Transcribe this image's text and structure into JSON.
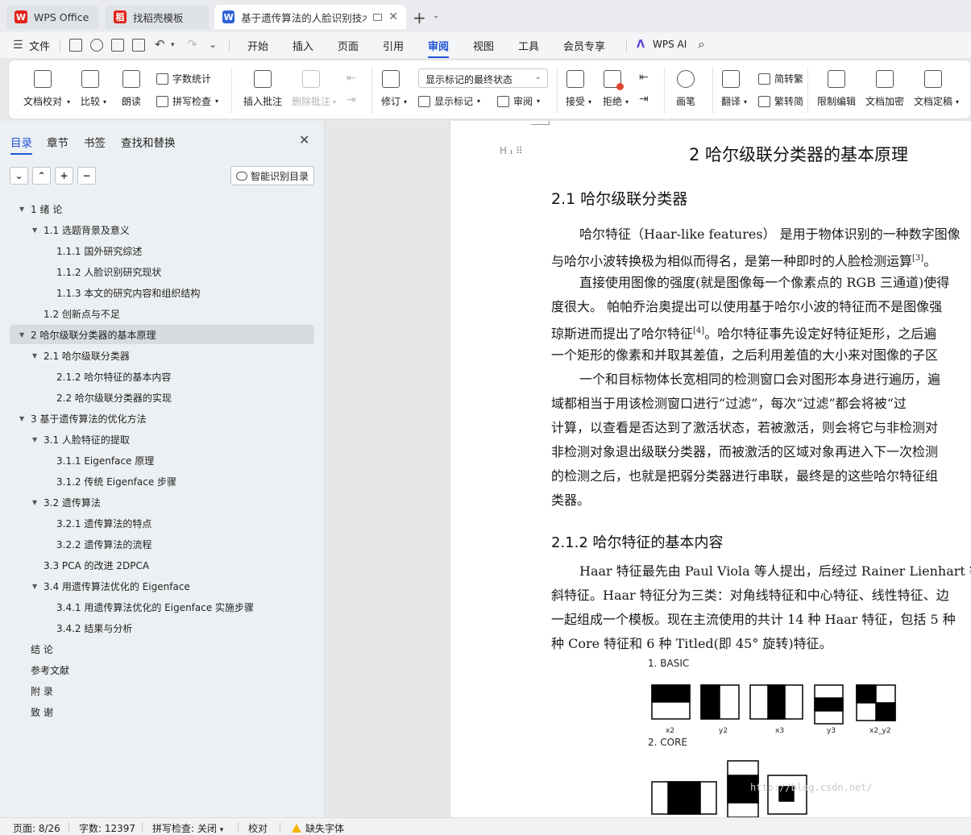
{
  "tabs": [
    {
      "label": "WPS Office",
      "logo": "W",
      "logo_color": "#e2231a"
    },
    {
      "label": "找稻壳模板",
      "logo": "稻",
      "logo_color": "#e2231a"
    },
    {
      "label": "基于遗传算法的人脸识别技术",
      "logo": "W",
      "logo_color": "#2e63d8"
    }
  ],
  "menu": {
    "file": "文件",
    "items": [
      "开始",
      "插入",
      "页面",
      "引用",
      "审阅",
      "视图",
      "工具",
      "会员专享"
    ],
    "active": "审阅",
    "ai": "WPS AI"
  },
  "ribbon": {
    "doc_check": "文档校对",
    "compare": "比较",
    "read_aloud": "朗读",
    "word_count": "字数统计",
    "spell_check": "拼写检查",
    "insert_comment": "插入批注",
    "delete_comment": "删除批注",
    "track_changes": "修订",
    "markup_mode": "显示标记的最终状态",
    "show_markup": "显示标记",
    "review": "审阅",
    "accept": "接受",
    "reject": "拒绝",
    "pen": "画笔",
    "translate": "翻译",
    "to_traditional": "简转繁",
    "to_simplified": "繁转简",
    "restrict_edit": "限制编辑",
    "encrypt": "文档加密",
    "finalize": "文档定稿"
  },
  "sidebar": {
    "tabs": [
      "目录",
      "章节",
      "书签",
      "查找和替换"
    ],
    "active_tab": "目录",
    "smart_toc": "智能识别目录",
    "toc": [
      {
        "label": "1  绪  论",
        "level": 1,
        "expanded": true
      },
      {
        "label": "1.1  选题背景及意义",
        "level": 2,
        "expanded": true
      },
      {
        "label": "1.1.1  国外研究综述",
        "level": 3
      },
      {
        "label": "1.1.2  人脸识别研究现状",
        "level": 3
      },
      {
        "label": "1.1.3 本文的研究内容和组织结构",
        "level": 3
      },
      {
        "label": "1.2  创新点与不足",
        "level": 2
      },
      {
        "label": "2 哈尔级联分类器的基本原理",
        "level": 1,
        "expanded": true,
        "selected": true
      },
      {
        "label": "2.1 哈尔级联分类器",
        "level": 2,
        "expanded": true
      },
      {
        "label": "2.1.2 哈尔特征的基本内容",
        "level": 3
      },
      {
        "label": "2.2  哈尔级联分类器的实现",
        "level": 3
      },
      {
        "label": "3 基于遗传算法的优化方法",
        "level": 1,
        "expanded": true
      },
      {
        "label": "3.1 人脸特征的提取",
        "level": 2,
        "expanded": true
      },
      {
        "label": "3.1.1 Eigenface 原理",
        "level": 3
      },
      {
        "label": "3.1.2 传统 Eigenface 步骤",
        "level": 3
      },
      {
        "label": "3.2  遗传算法",
        "level": 2,
        "expanded": true
      },
      {
        "label": "3.2.1 遗传算法的特点",
        "level": 3
      },
      {
        "label": "3.2.2  遗传算法的流程",
        "level": 3
      },
      {
        "label": "3.3 PCA 的改进 2DPCA",
        "level": 2
      },
      {
        "label": "3.4  用遗传算法优化的 Eigenface",
        "level": 2,
        "expanded": true
      },
      {
        "label": "3.4.1 用遗传算法优化的 Eigenface 实施步骤",
        "level": 3
      },
      {
        "label": "3.4.2  结果与分析",
        "level": 3
      },
      {
        "label": "结  论",
        "level": 1
      },
      {
        "label": "参考文献",
        "level": 1
      },
      {
        "label": "附  录",
        "level": 1
      },
      {
        "label": "致  谢",
        "level": 1
      }
    ]
  },
  "document": {
    "h1": "2 哈尔级联分类器的基本原理",
    "h2_1": "2.1 哈尔级联分类器",
    "para1": [
      "哈尔特征（Haar-like features） 是用于物体识别的一种数字图像",
      "与哈尔小波转换极为相似而得名，是第一种即时的人脸检测运算"
    ],
    "ref3": "[3]",
    "para1_end": "。",
    "para2": [
      "直接使用图像的强度(就是图像每一个像素点的 RGB 三通道)使得",
      "度很大。 帕帕乔治奥提出可以使用基于哈尔小波的特征而不是图像强",
      "琼斯进而提出了哈尔特征",
      "一个矩形的像素和并取其差值，之后利用差值的大小来对图像的子区"
    ],
    "ref4": "[4]",
    "para2_line3_end": "。哈尔特征事先设定好特征矩形，之后遍",
    "para3": [
      "一个和目标物体长宽相同的检测窗口会对图形本身进行遍历，遍",
      "域都相当于用该检测窗口进行“过滤”，每次“过滤”都会将被“过",
      "计算，以查看是否达到了激活状态，若被激活，则会将它与非检测对",
      "非检测对象退出级联分类器，而被激活的区域对象再进入下一次检测",
      "的检测之后，也就是把弱分类器进行串联，最终是的这些哈尔特征组",
      "类器。"
    ],
    "h3_1": "2.1.2 哈尔特征的基本内容",
    "para4": [
      "Haar 特征最先由 Paul Viola 等人提出，后经过 Rainer Lienhart 等扩",
      "斜特征。Haar 特征分为三类：对角线特征和中心特征、线性特征、边",
      "一起组成一个模板。现在主流使用的共计 14 种 Haar 特征，包括 5 种",
      "种 Core 特征和 6 种 Titled(即 45°  旋转)特征。"
    ],
    "figure": {
      "basic_label": "1. BASIC",
      "basic_names": [
        "x2",
        "y2",
        "x3",
        "y3",
        "x2_y2"
      ],
      "core_label": "2. CORE",
      "watermark": "http://blog.csdn.net/"
    }
  },
  "status": {
    "page": "页面: 8/26",
    "words": "字数: 12397",
    "spell": "拼写检查: 关闭",
    "proof": "校对",
    "missing_font": "缺失字体"
  }
}
